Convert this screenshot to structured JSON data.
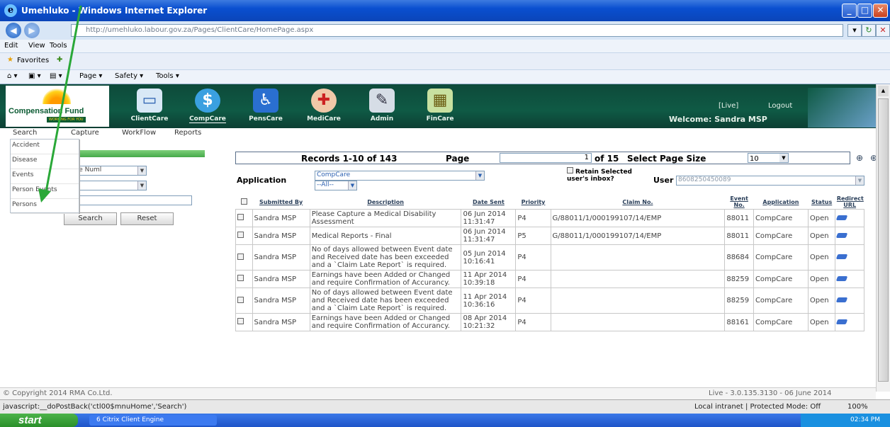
{
  "window": {
    "title": "Umehluko - Windows Internet Explorer",
    "url": "http://umehluko.labour.gov.za/Pages/ClientCare/HomePage.aspx"
  },
  "browser_menu": [
    "Edit",
    "View",
    "Tools"
  ],
  "favorites": {
    "label": "Favorites"
  },
  "command_bar": [
    "Page ▾",
    "Safety ▾",
    "Tools ▾"
  ],
  "app": {
    "logo": {
      "name": "Compensation Fund",
      "tagline": "WORKING FOR YOU"
    },
    "modules": [
      {
        "label": "ClientCare",
        "icon": "monitor-icon"
      },
      {
        "label": "CompCare",
        "icon": "globe-icon"
      },
      {
        "label": "PensCare",
        "icon": "wheelchair-icon"
      },
      {
        "label": "MediCare",
        "icon": "nurse-icon"
      },
      {
        "label": "Admin",
        "icon": "admin-icon"
      },
      {
        "label": "FinCare",
        "icon": "finance-icon"
      }
    ],
    "env": "[Live]",
    "logout": "Logout",
    "welcome": "Welcome: Sandra MSP",
    "tabs": [
      "Search",
      "Capture",
      "WorkFlow",
      "Reports"
    ],
    "search_menu": [
      "Accident",
      "Disease",
      "Events",
      "Person Events",
      "Persons"
    ]
  },
  "search_panel": {
    "type_select": "ence Numl",
    "search_button": "Search",
    "reset_button": "Reset"
  },
  "records": {
    "text": "Records 1-10 of 143",
    "page_label": "Page",
    "page_value": "1",
    "of_pages": "of 15",
    "page_size_label": "Select Page Size",
    "page_size": "10"
  },
  "filters": {
    "application_label": "Application",
    "application_value": "CompCare",
    "application_sub": "--All--",
    "retain_label": "Retain Selected user's inbox?",
    "user_label": "User",
    "user_value": "8608250450089"
  },
  "table": {
    "headers": [
      "Submitted By",
      "Description",
      "Date Sent",
      "Priority",
      "Claim No.",
      "Event No.",
      "Application",
      "Status",
      "Redirect URL"
    ],
    "rows": [
      [
        "Sandra MSP",
        "Please Capture a Medical Disability Assessment",
        "06 Jun 2014 11:31:47",
        "P4",
        "G/88011/1/000199107/14/EMP",
        "88011",
        "CompCare",
        "Open"
      ],
      [
        "Sandra MSP",
        "Medical Reports - Final",
        "06 Jun 2014 11:31:47",
        "P5",
        "G/88011/1/000199107/14/EMP",
        "88011",
        "CompCare",
        "Open"
      ],
      [
        "Sandra MSP",
        "No of days allowed between Event date and Received date has been exceeded and a `Claim Late Report` is required.",
        "05 Jun 2014 10:16:41",
        "P4",
        "",
        "88684",
        "CompCare",
        "Open"
      ],
      [
        "Sandra MSP",
        "Earnings have been Added or Changed and require Confirmation of Accurancy.",
        "11 Apr 2014 10:39:18",
        "P4",
        "",
        "88259",
        "CompCare",
        "Open"
      ],
      [
        "Sandra MSP",
        "No of days allowed between Event date and Received date has been exceeded and a `Claim Late Report` is required.",
        "11 Apr 2014 10:36:16",
        "P4",
        "",
        "88259",
        "CompCare",
        "Open"
      ],
      [
        "Sandra MSP",
        "Earnings have been Added or Changed and require Confirmation of Accurancy.",
        "08 Apr 2014 10:21:32",
        "P4",
        "",
        "88161",
        "CompCare",
        "Open"
      ]
    ]
  },
  "footer": {
    "copyright": "© Copyright 2014 RMA Co.Ltd.",
    "version": "Live - 3.0.135.3130 - 06 June 2014"
  },
  "statusbar": {
    "text": "javascript:__doPostBack('ctl00$mnuHome','Search')",
    "zone": "Local intranet | Protected Mode: Off",
    "zoom": "100%"
  },
  "taskbar": {
    "start": "start",
    "task": "6 Citrix Client Engine",
    "clock": "02:34 PM"
  }
}
